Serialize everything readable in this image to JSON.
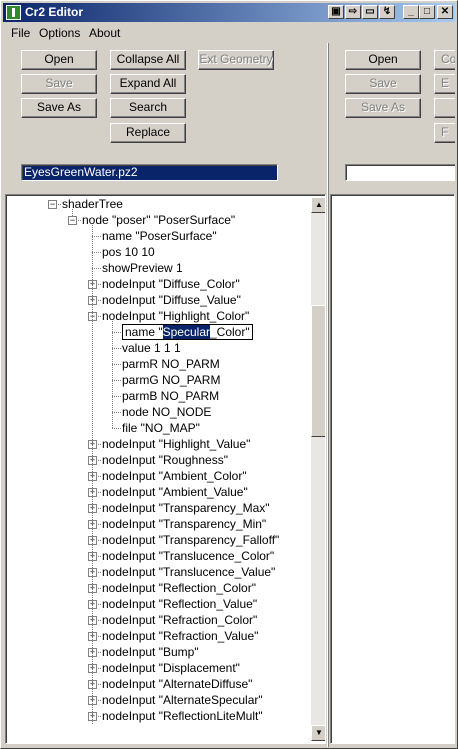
{
  "window": {
    "title": "Cr2 Editor"
  },
  "titlebar_buttons": [
    "minimize",
    "maximize",
    "close"
  ],
  "menu": [
    {
      "label": "File",
      "mnemonic": "F"
    },
    {
      "label": "Options",
      "mnemonic": "O"
    },
    {
      "label": "About",
      "mnemonic": "A"
    }
  ],
  "left_panel": {
    "open": "Open",
    "save": "Save",
    "save_as": "Save As",
    "collapse_all": "Collapse All",
    "expand_all": "Expand All",
    "search": "Search",
    "replace": "Replace",
    "ext_geometry": "Ext Geometry",
    "filename": "EyesGreenWater.pz2"
  },
  "right_panel": {
    "open": "Open",
    "save": "Save",
    "save_as": "Save As",
    "collapse_all": "Co",
    "expand_all": "E",
    "replace": "F",
    "filename": ""
  },
  "tree": {
    "rows": [
      {
        "text": "shaderTree",
        "level": 0,
        "expander": "minus"
      },
      {
        "text": "node \"poser\" \"PoserSurface\"",
        "level": 1,
        "expander": "minus"
      },
      {
        "text": "name \"PoserSurface\"",
        "level": 2,
        "expander": "none"
      },
      {
        "text": "pos 10 10",
        "level": 2,
        "expander": "none"
      },
      {
        "text": "showPreview 1",
        "level": 2,
        "expander": "none"
      },
      {
        "text": "nodeInput \"Diffuse_Color\"",
        "level": 2,
        "expander": "plus"
      },
      {
        "text": "nodeInput \"Diffuse_Value\"",
        "level": 2,
        "expander": "plus"
      },
      {
        "text": "nodeInput \"Highlight_Color\"",
        "level": 2,
        "expander": "minus"
      },
      {
        "text": "name \"Specular_Color\"",
        "level": 3,
        "expander": "none",
        "editing": true,
        "edit_prefix": "name \"",
        "edit_selected": "Specular",
        "edit_suffix": "_Color\""
      },
      {
        "text": "value 1 1 1",
        "level": 3,
        "expander": "none"
      },
      {
        "text": "parmR NO_PARM",
        "level": 3,
        "expander": "none"
      },
      {
        "text": "parmG NO_PARM",
        "level": 3,
        "expander": "none"
      },
      {
        "text": "parmB NO_PARM",
        "level": 3,
        "expander": "none"
      },
      {
        "text": "node NO_NODE",
        "level": 3,
        "expander": "none"
      },
      {
        "text": "file \"NO_MAP\"",
        "level": 3,
        "expander": "none"
      },
      {
        "text": "nodeInput \"Highlight_Value\"",
        "level": 2,
        "expander": "plus"
      },
      {
        "text": "nodeInput \"Roughness\"",
        "level": 2,
        "expander": "plus"
      },
      {
        "text": "nodeInput \"Ambient_Color\"",
        "level": 2,
        "expander": "plus"
      },
      {
        "text": "nodeInput \"Ambient_Value\"",
        "level": 2,
        "expander": "plus"
      },
      {
        "text": "nodeInput \"Transparency_Max\"",
        "level": 2,
        "expander": "plus"
      },
      {
        "text": "nodeInput \"Transparency_Min\"",
        "level": 2,
        "expander": "plus"
      },
      {
        "text": "nodeInput \"Transparency_Falloff\"",
        "level": 2,
        "expander": "plus"
      },
      {
        "text": "nodeInput \"Translucence_Color\"",
        "level": 2,
        "expander": "plus"
      },
      {
        "text": "nodeInput \"Translucence_Value\"",
        "level": 2,
        "expander": "plus"
      },
      {
        "text": "nodeInput \"Reflection_Color\"",
        "level": 2,
        "expander": "plus"
      },
      {
        "text": "nodeInput \"Reflection_Value\"",
        "level": 2,
        "expander": "plus"
      },
      {
        "text": "nodeInput \"Refraction_Color\"",
        "level": 2,
        "expander": "plus"
      },
      {
        "text": "nodeInput \"Refraction_Value\"",
        "level": 2,
        "expander": "plus"
      },
      {
        "text": "nodeInput \"Bump\"",
        "level": 2,
        "expander": "plus"
      },
      {
        "text": "nodeInput \"Displacement\"",
        "level": 2,
        "expander": "plus"
      },
      {
        "text": "nodeInput \"AlternateDiffuse\"",
        "level": 2,
        "expander": "plus"
      },
      {
        "text": "nodeInput \"AlternateSpecular\"",
        "level": 2,
        "expander": "plus"
      },
      {
        "text": "nodeInput \"ReflectionLiteMult\"",
        "level": 2,
        "expander": "plus"
      }
    ]
  },
  "colors": {
    "face": "#d4d0c8",
    "titlebar_start": "#0a246a",
    "titlebar_end": "#a6caf0",
    "selection": "#0a246a"
  }
}
